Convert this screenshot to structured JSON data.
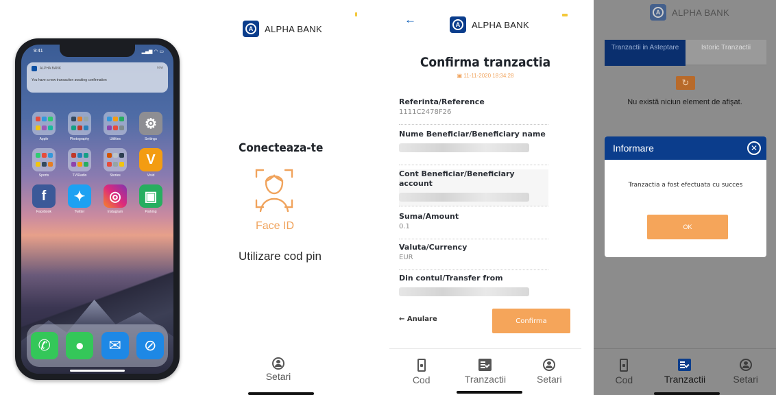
{
  "brand": {
    "name": "ALPHA BANK",
    "primary_color": "#0b3d8c",
    "accent_color": "#f5a55a"
  },
  "phone_lockscreen": {
    "time": "9:41",
    "notification": {
      "app": "ALPHA BANK",
      "when": "now",
      "message": "You have a new transaction awaiting confirmation"
    },
    "apps": [
      {
        "label": "Apple",
        "icon": "folder-icon"
      },
      {
        "label": "Photography",
        "icon": "folder-icon"
      },
      {
        "label": "Utilities",
        "icon": "folder-icon"
      },
      {
        "label": "Settings",
        "icon": "settings-gear-icon"
      },
      {
        "label": "Sports",
        "icon": "folder-icon"
      },
      {
        "label": "TV/Radio",
        "icon": "folder-icon"
      },
      {
        "label": "Stories",
        "icon": "folder-icon"
      },
      {
        "label": "Vivid",
        "icon": "vivid-app-icon"
      },
      {
        "label": "Facebook",
        "icon": "facebook-icon"
      },
      {
        "label": "Twitter",
        "icon": "twitter-icon"
      },
      {
        "label": "Instagram",
        "icon": "instagram-icon"
      },
      {
        "label": "Parking",
        "icon": "parking-app-icon"
      }
    ],
    "dock": [
      "phone-icon",
      "messages-icon",
      "mail-icon",
      "safari-icon"
    ]
  },
  "login": {
    "title": "Conecteaza-te",
    "faceid_label": "Face ID",
    "pin_option": "Utilizare cod pin",
    "settings_label": "Setari"
  },
  "confirm": {
    "title": "Confirma tranzactia",
    "datetime": "11-11-2020 18:34:28",
    "fields": [
      {
        "label": "Referinta/Reference",
        "value": "1111C2478F26"
      },
      {
        "label": "Nume Beneficiar/Beneficiary name",
        "value": ""
      },
      {
        "label": "Cont Beneficiar/Beneficiary account",
        "value": ""
      },
      {
        "label": "Suma/Amount",
        "value": "0.1"
      },
      {
        "label": "Valuta/Currency",
        "value": "EUR"
      },
      {
        "label": "Din contul/Transfer from",
        "value": ""
      }
    ],
    "cancel_label": "← Anulare",
    "confirm_label": "Confirma"
  },
  "tabs": {
    "cod": "Cod",
    "tranzactii": "Tranzactii",
    "setari": "Setari"
  },
  "history": {
    "tab_pending": "Tranzactii in Asteptare",
    "tab_history": "Istoric Tranzactii",
    "empty_message": "Nu există niciun element de afişat.",
    "refresh_icon": "↻",
    "modal": {
      "title": "Informare",
      "message": "Tranzactia a fost efectuata cu succes",
      "ok_label": "OK"
    }
  }
}
